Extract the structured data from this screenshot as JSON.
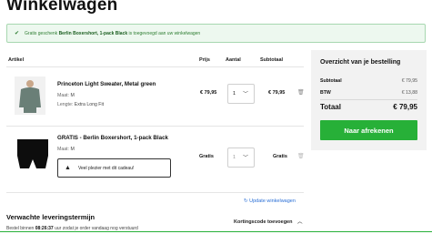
{
  "page": {
    "title": "Winkelwagen"
  },
  "notice": {
    "prefix": "Gratis geschenk",
    "product": "Berlin Boxershort, 1-pack Black",
    "suffix": "is toegevoegd aan uw winkelwagen"
  },
  "table": {
    "headers": {
      "article": "Artikel",
      "price": "Prijs",
      "quantity": "Aantal",
      "subtotal": "Subtotaal"
    },
    "items": [
      {
        "name": "Princeton Light Sweater, Metal green",
        "size_label": "Maat:",
        "size": "M",
        "length_label": "Lengte:",
        "length": "Extra Long Fit",
        "price": "€ 79,95",
        "qty": "1",
        "subtotal": "€ 79,95"
      },
      {
        "name": "GRATIS - Berlin Boxershort, 1-pack Black",
        "size_label": "Maat:",
        "size": "M",
        "gift_message": "Veel plezier met dit cadeau!",
        "price": "Gratis",
        "qty": "1",
        "subtotal": "Gratis"
      }
    ]
  },
  "summary": {
    "title": "Overzicht van je bestelling",
    "subtotal_label": "Subtotaal",
    "subtotal": "€ 79,95",
    "vat_label": "BTW",
    "vat": "€ 13,88",
    "total_label": "Totaal",
    "total": "€ 79,95",
    "checkout": "Naar afrekenen"
  },
  "update_link": "Update winkelwagen",
  "delivery": {
    "title": "Verwachte leveringstermijn",
    "prefix": "Bestel binnen",
    "time": "08:26:37",
    "suffix": "uur zodat je order vandaag nog verstuurd"
  },
  "coupon": "Kortingscode toevoegen",
  "colors": {
    "accent": "#27b038",
    "notice_bg": "#edf8ef",
    "link": "#2a6fd6"
  },
  "icons": {
    "notice": "check-icon",
    "qty": "chevron-down-icon",
    "remove": "trash-icon",
    "gift": "warning-icon",
    "update": "refresh-icon",
    "coupon": "chevron-up-icon"
  }
}
